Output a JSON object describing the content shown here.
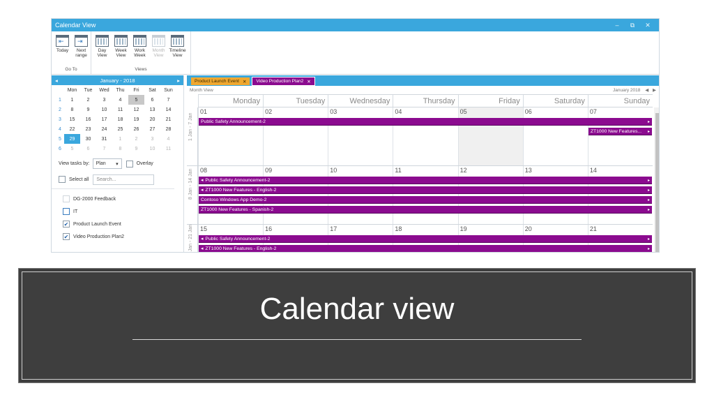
{
  "window": {
    "title": "Calendar View",
    "controls": [
      "‒",
      "⧉",
      "✕"
    ]
  },
  "ribbon": {
    "groups": [
      {
        "label": "Go To",
        "buttons": [
          {
            "label": "Today",
            "icon": "today-icon"
          },
          {
            "label": "Next range",
            "icon": "next-range-icon"
          }
        ]
      },
      {
        "label": "Views",
        "buttons": [
          {
            "label": "Day View",
            "icon": "day-view-icon"
          },
          {
            "label": "Week View",
            "icon": "week-view-icon"
          },
          {
            "label": "Work Week",
            "icon": "work-week-icon"
          },
          {
            "label": "Month View",
            "icon": "month-view-icon",
            "disabled": true
          },
          {
            "label": "Timeline View",
            "icon": "timeline-view-icon"
          }
        ]
      }
    ]
  },
  "mini_calendar": {
    "month_label": "January - 2018",
    "prev": "◂",
    "next": "▸",
    "weekdays": [
      "Mon",
      "Tue",
      "Wed",
      "Thu",
      "Fri",
      "Sat",
      "Sun"
    ],
    "weeks": [
      {
        "wk": "1",
        "days": [
          "1",
          "2",
          "3",
          "4",
          "5",
          "6",
          "7"
        ]
      },
      {
        "wk": "2",
        "days": [
          "8",
          "9",
          "10",
          "11",
          "12",
          "13",
          "14"
        ]
      },
      {
        "wk": "3",
        "days": [
          "15",
          "16",
          "17",
          "18",
          "19",
          "20",
          "21"
        ]
      },
      {
        "wk": "4",
        "days": [
          "22",
          "23",
          "24",
          "25",
          "26",
          "27",
          "28"
        ]
      },
      {
        "wk": "5",
        "days": [
          "29",
          "30",
          "31",
          "1",
          "2",
          "3",
          "4"
        ]
      },
      {
        "wk": "6",
        "days": [
          "5",
          "6",
          "7",
          "8",
          "9",
          "10",
          "11"
        ]
      }
    ],
    "selected_day": "5",
    "today_day": "29"
  },
  "filter": {
    "view_tasks_by_label": "View tasks by:",
    "view_tasks_by_value": "Plan",
    "overlay_label": "Overlay",
    "select_all_label": "Select all",
    "search_placeholder": "Search...",
    "plans": [
      {
        "name": "DG-2000 Feedback",
        "checked": false,
        "checkbox": false
      },
      {
        "name": "IT",
        "checked": false,
        "checkbox": true
      },
      {
        "name": "Product Launch Event",
        "checked": true,
        "checkbox": true
      },
      {
        "name": "Video Production Plan2",
        "checked": true,
        "checkbox": true
      }
    ]
  },
  "calendar": {
    "tabs": [
      {
        "label": "Product Launch Event",
        "close": "✕",
        "color": "#f0a830"
      },
      {
        "label": "Video Production Plan2",
        "close": "✕",
        "color": "#8b0b8f"
      }
    ],
    "view_name": "Month View",
    "month_label": "January 2018",
    "nav_prev": "◀",
    "nav_next": "▶",
    "day_headers": [
      "Monday",
      "Tuesday",
      "Wednesday",
      "Thursday",
      "Friday",
      "Saturday",
      "Sunday"
    ],
    "weeks": [
      {
        "label": "1 Jan - 7 Jan",
        "days": [
          "01",
          "02",
          "03",
          "04",
          "05",
          "06",
          "07"
        ],
        "events": [
          {
            "title": "Public Safety Announcement-2",
            "start": 0,
            "span": 7,
            "row": 0,
            "left_arrow": "",
            "right_arrow": "▸"
          },
          {
            "title": "ZT1000 New Features...",
            "start": 6,
            "span": 1,
            "row": 1,
            "left_arrow": "",
            "right_arrow": "▸"
          }
        ]
      },
      {
        "label": "8 Jan - 14 Jan",
        "days": [
          "08",
          "09",
          "10",
          "11",
          "12",
          "13",
          "14"
        ],
        "events": [
          {
            "title": "Public Safety Announcement-2",
            "start": 0,
            "span": 7,
            "row": 0,
            "left_arrow": "◂",
            "right_arrow": "▸"
          },
          {
            "title": "ZT1000 New Features - English-2",
            "start": 0,
            "span": 7,
            "row": 1,
            "left_arrow": "◂",
            "right_arrow": "▸"
          },
          {
            "title": "Contoso Windows App Demo-2",
            "start": 0,
            "span": 7,
            "row": 2,
            "left_arrow": "",
            "right_arrow": "▸"
          },
          {
            "title": "ZT1000 New Features - Spanish-2",
            "start": 0,
            "span": 7,
            "row": 3,
            "left_arrow": "",
            "right_arrow": "▸"
          }
        ]
      },
      {
        "label": "15 Jan - 21 Jan",
        "days": [
          "15",
          "16",
          "17",
          "18",
          "19",
          "20",
          "21"
        ],
        "events": [
          {
            "title": "Public Safety Announcement-2",
            "start": 0,
            "span": 7,
            "row": 0,
            "left_arrow": "◂",
            "right_arrow": "▸"
          },
          {
            "title": "ZT1000 New Features - English-2",
            "start": 0,
            "span": 7,
            "row": 1,
            "left_arrow": "◂",
            "right_arrow": "▸"
          }
        ]
      }
    ]
  },
  "banner": {
    "title": "Calendar view"
  }
}
